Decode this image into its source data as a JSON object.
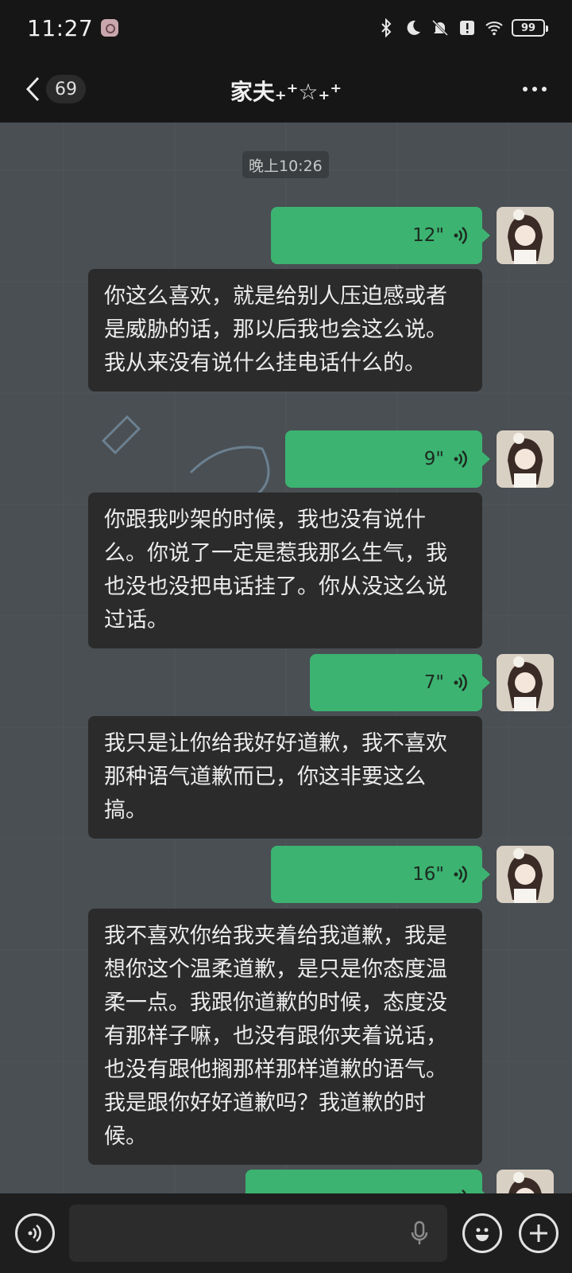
{
  "status_bar": {
    "time": "11:27",
    "battery": "99",
    "icons": [
      "bluetooth-icon",
      "moon-icon",
      "bell-off-icon",
      "alert-icon",
      "wifi-icon",
      "battery-icon"
    ]
  },
  "header": {
    "unread_count": "69",
    "title": "家夫₊⁺☆₊⁺"
  },
  "chat": {
    "timestamp": "晚上10:26",
    "messages": [
      {
        "type": "voice",
        "duration": "12\""
      },
      {
        "type": "text",
        "text": "你这么喜欢，就是给别人压迫感或者是威胁的话，那以后我也会这么说。我从来没有说什么挂电话什么的。"
      },
      {
        "type": "voice",
        "duration": "9\""
      },
      {
        "type": "text",
        "text": "你跟我吵架的时候，我也没有说什么。你说了一定是惹我那么生气，我也没也没把电话挂了。你从没这么说过话。"
      },
      {
        "type": "voice",
        "duration": "7\""
      },
      {
        "type": "text",
        "text": "我只是让你给我好好道歉，我不喜欢那种语气道歉而已，你这非要这么搞。"
      },
      {
        "type": "voice",
        "duration": "16\""
      },
      {
        "type": "text",
        "text": "我不喜欢你给我夹着给我道歉，我是想你这个温柔道歉，是只是你态度温柔一点。我跟你道歉的时候，态度没有那样子嘛，也没有跟你夹着说话，也没有跟他搁那样那样道歉的语气。我是跟你好好道歉吗？我道歉的时候。"
      },
      {
        "type": "voice",
        "duration": ""
      }
    ]
  },
  "colors": {
    "voice_bubble": "#3cb371",
    "text_bubble": "#2b2b2b",
    "chat_bg": "#494f53",
    "bar_bg": "#161616"
  }
}
